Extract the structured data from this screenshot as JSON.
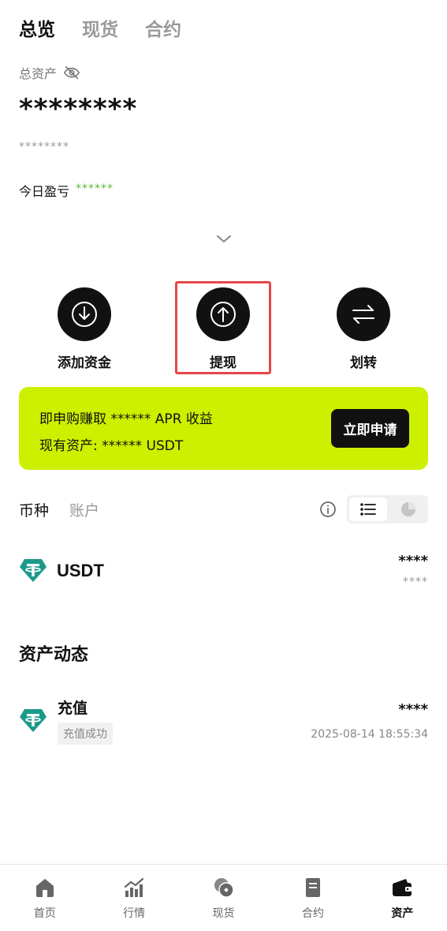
{
  "top_tabs": [
    {
      "label": "总览",
      "active": true
    },
    {
      "label": "现货",
      "active": false
    },
    {
      "label": "合约",
      "active": false
    }
  ],
  "overview": {
    "total_label": "总资产",
    "total_value": "********",
    "total_sub": "********",
    "pnl_label": "今日盈亏",
    "pnl_value": "******"
  },
  "actions": [
    {
      "label": "添加资金",
      "icon": "deposit-icon"
    },
    {
      "label": "提现",
      "icon": "withdraw-icon"
    },
    {
      "label": "划转",
      "icon": "transfer-icon"
    }
  ],
  "promo": {
    "line1": "即申购赚取 ****** APR 收益",
    "line2": "现有资产: ****** USDT",
    "button": "立即申请"
  },
  "asset_tabs": [
    {
      "label": "币种",
      "active": true
    },
    {
      "label": "账户",
      "active": false
    }
  ],
  "assets": [
    {
      "name": "USDT",
      "amount": "****",
      "sub_amount": "****"
    }
  ],
  "activity": {
    "title": "资产动态",
    "items": [
      {
        "title": "充值",
        "status": "充值成功",
        "amount": "****",
        "time": "2025-08-14 18:55:34"
      }
    ]
  },
  "bottom_nav": [
    {
      "label": "首页",
      "icon": "home-icon",
      "active": false
    },
    {
      "label": "行情",
      "icon": "market-icon",
      "active": false
    },
    {
      "label": "现货",
      "icon": "spot-icon",
      "active": false
    },
    {
      "label": "合约",
      "icon": "contract-icon",
      "active": false
    },
    {
      "label": "资产",
      "icon": "wallet-icon",
      "active": true
    }
  ],
  "colors": {
    "accent": "#ccf000",
    "positive": "#5db83b",
    "usdt": "#1b9a8a",
    "highlight": "#e64646"
  }
}
